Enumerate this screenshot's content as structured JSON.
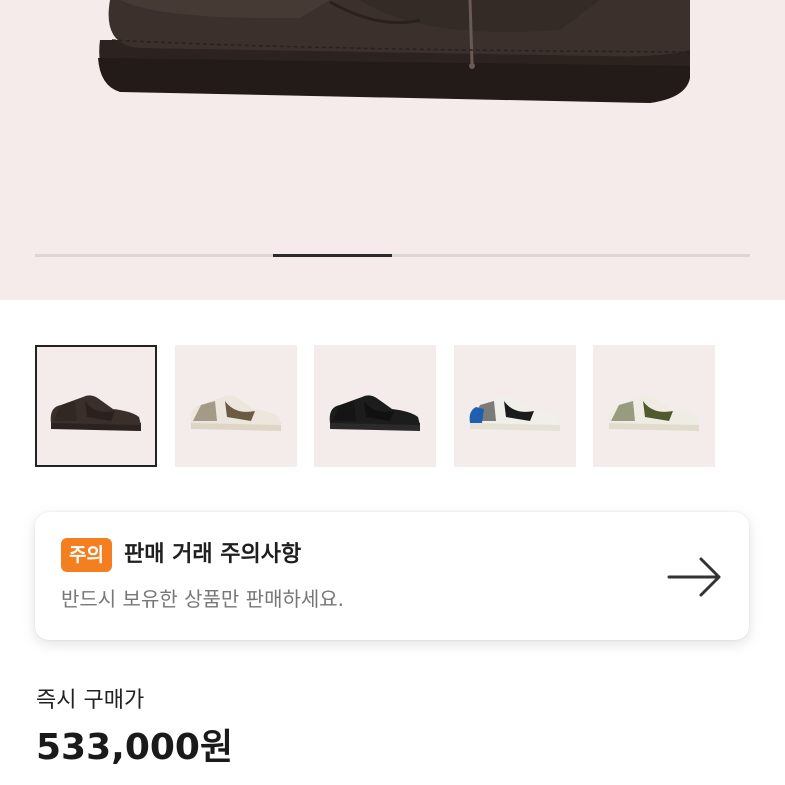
{
  "gallery": {
    "current_index": 3,
    "total": 6,
    "thumbnails": [
      {
        "label": "brown suede sneaker",
        "icon": "sneaker-image",
        "colors": {
          "body": "#3a2f2b",
          "accent": "#2a211e",
          "sole": "#2c2320"
        }
      },
      {
        "label": "sail olive sneaker",
        "icon": "sneaker-image",
        "colors": {
          "body": "#ece6dc",
          "accent": "#6b5a44",
          "sole": "#ded5c6"
        }
      },
      {
        "label": "black sneaker",
        "icon": "sneaker-image",
        "colors": {
          "body": "#1c1c1c",
          "accent": "#111111",
          "sole": "#2a2a2a"
        }
      },
      {
        "label": "blue black sneaker",
        "icon": "sneaker-image",
        "colors": {
          "body": "#f1efe9",
          "accent": "#1b1b1b",
          "sole": "#e6e1d6",
          "toe": "#1f5fb0"
        }
      },
      {
        "label": "olive green sneaker",
        "icon": "sneaker-image",
        "colors": {
          "body": "#efece4",
          "accent": "#4f5a2e",
          "sole": "#e0dbcd"
        }
      }
    ],
    "selected": 0
  },
  "notice": {
    "badge": "주의",
    "title": "판매 거래 주의사항",
    "subtitle": "반드시 보유한 상품만 판매하세요.",
    "arrow_icon": "arrow-right-icon",
    "badge_color": "#f37f21"
  },
  "pricing": {
    "label": "즉시 구매가",
    "price": "533,000원"
  },
  "colors": {
    "hero_bg": "#f4ebea",
    "thumb_bg": "#f3ecea",
    "shoe_main": "#3b302c"
  }
}
